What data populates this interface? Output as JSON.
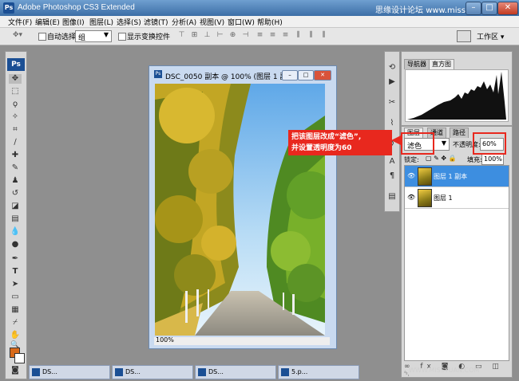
{
  "window": {
    "title": "Adobe Photoshop CS3 Extended",
    "app_icon": "Ps",
    "watermark_top": "思缘设计论坛",
    "watermark_top_url": "www.missyuan.com",
    "min_icon": "minimize-icon",
    "max_icon": "maximize-icon",
    "close_icon": "close-icon"
  },
  "menu": [
    "文件(F)",
    "编辑(E)",
    "图像(I)",
    "图层(L)",
    "选择(S)",
    "滤镜(T)",
    "分析(A)",
    "视图(V)",
    "窗口(W)",
    "帮助(H)"
  ],
  "options": {
    "auto_select_label": "自动选择:",
    "auto_select_value": "组",
    "show_transform_label": "显示变换控件",
    "workspace_label": "工作区 ▾"
  },
  "tools": {
    "logo": "Ps"
  },
  "document": {
    "title": "DSC_0050 副本 @ 100% (图层 1 副...",
    "zoom": "100%"
  },
  "nav_panel": {
    "tabs": [
      "导航器",
      "直方图"
    ]
  },
  "layers_panel": {
    "tabs": [
      "图层",
      "通道",
      "路径"
    ],
    "blend_mode": "滤色",
    "opacity_label": "不透明度:",
    "opacity_value": "60%",
    "lock_label": "锁定:",
    "fill_label": "填充:",
    "fill_value": "100%",
    "layers": [
      {
        "name": "图层 1 副本",
        "selected": true
      },
      {
        "name": "图层 1",
        "selected": false
      }
    ],
    "bottom_icons": "∞ fx ◙ ◐ ▭ ◫ ␡"
  },
  "annotation": {
    "line1": "把该图层改成“滤色”,",
    "line2": "并设置透明度为60",
    "color": "#e8281e"
  },
  "taskbar": [
    {
      "label": "DS..."
    },
    {
      "label": "DS..."
    },
    {
      "label": "DS..."
    },
    {
      "label": "5.p..."
    }
  ],
  "watermark_bottom": "WWW.MISSYUAN.COM"
}
